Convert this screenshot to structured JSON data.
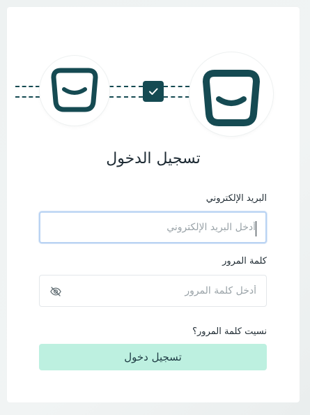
{
  "login": {
    "title": "تسجيل الدخول",
    "email_label": "البريد الإلكتروني",
    "email_placeholder": "أدخل البريد الإلكتروني",
    "email_value": "",
    "password_label": "كلمة المرور",
    "password_placeholder": "أدخل كلمة المرور",
    "password_value": "",
    "forgot_password": "نسيت كلمة المرور؟",
    "submit_label": "تسجيل دخول"
  },
  "icons": {
    "small_logo": "smile-logo-icon",
    "large_logo": "smile-logo-icon",
    "connector": "checkmark-icon",
    "password_toggle": "eye-slash-icon"
  },
  "colors": {
    "brand": "#154a52",
    "button_bg": "#bdf0e0",
    "focus_border": "#b9d3f3"
  }
}
